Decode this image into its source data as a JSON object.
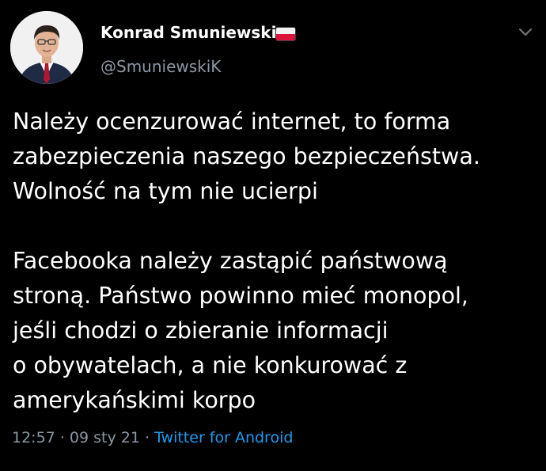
{
  "author": {
    "display_name": "Konrad Smuniewski",
    "handle": "@SmuniewskiK",
    "flag_icon": "poland-flag-icon",
    "avatar_icon": "profile-avatar"
  },
  "menu": {
    "icon": "chevron-down-icon"
  },
  "tweet": {
    "paragraph1": [
      "Należy ocenzurować internet, to forma",
      "zabezpieczenia naszego bezpieczeństwa.",
      "Wolność na tym nie ucierpi"
    ],
    "paragraph2": [
      "Facebooka należy zastąpić państwową",
      "stroną. Państwo powinno mieć monopol,",
      "jeśli chodzi o zbieranie informacji",
      "o obywatelach, a nie konkurować z",
      "amerykańskimi korpo"
    ]
  },
  "meta": {
    "time": "12:57",
    "separator": "·",
    "date": "09 sty 21",
    "source": "Twitter for Android"
  },
  "colors": {
    "background": "#000000",
    "text": "#ffffff",
    "muted": "#8b98a5",
    "link": "#1d9bf0"
  }
}
